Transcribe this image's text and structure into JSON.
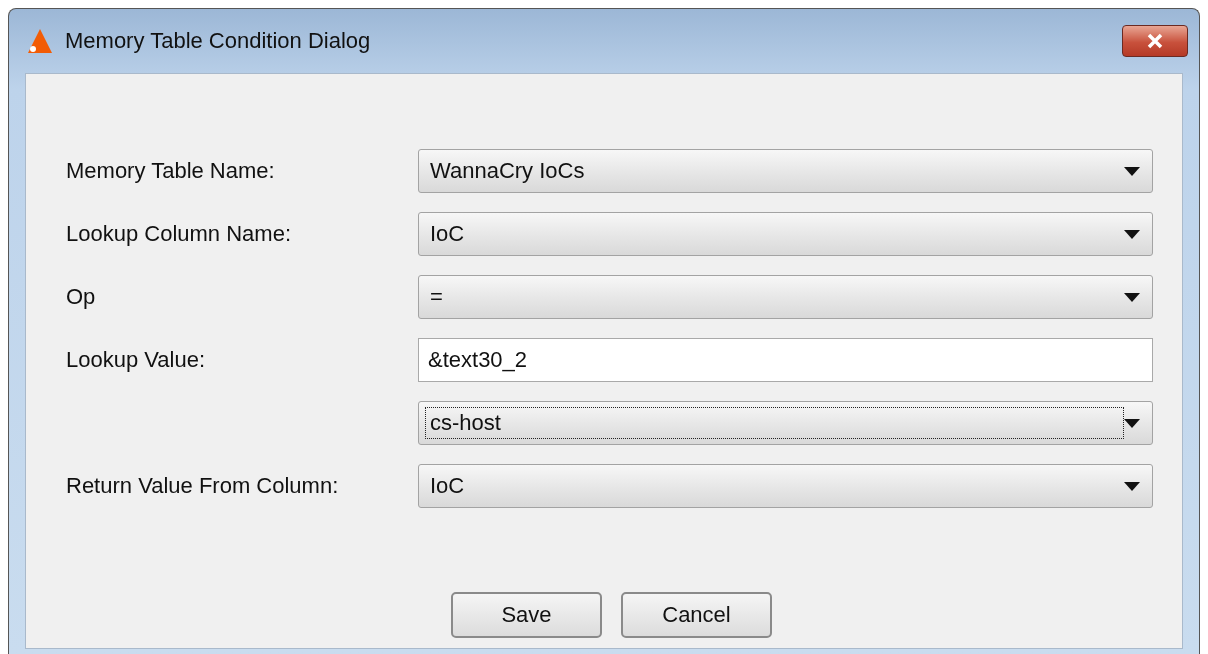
{
  "window": {
    "title": "Memory Table Condition Dialog"
  },
  "fields": [
    {
      "kind": "combo",
      "label": "Memory Table Name:",
      "value": "WannaCry IoCs",
      "focused": false
    },
    {
      "kind": "combo",
      "label": "Lookup Column Name:",
      "value": "IoC",
      "focused": false
    },
    {
      "kind": "combo",
      "label": "Op",
      "value": "=",
      "focused": false
    },
    {
      "kind": "text",
      "label": "Lookup Value:",
      "value": "&text30_2"
    },
    {
      "kind": "combo",
      "value": "cs-host",
      "focused": true
    },
    {
      "kind": "combo",
      "label": "Return Value From Column:",
      "value": "IoC",
      "focused": false
    }
  ],
  "buttons": [
    "Save",
    "Cancel"
  ]
}
